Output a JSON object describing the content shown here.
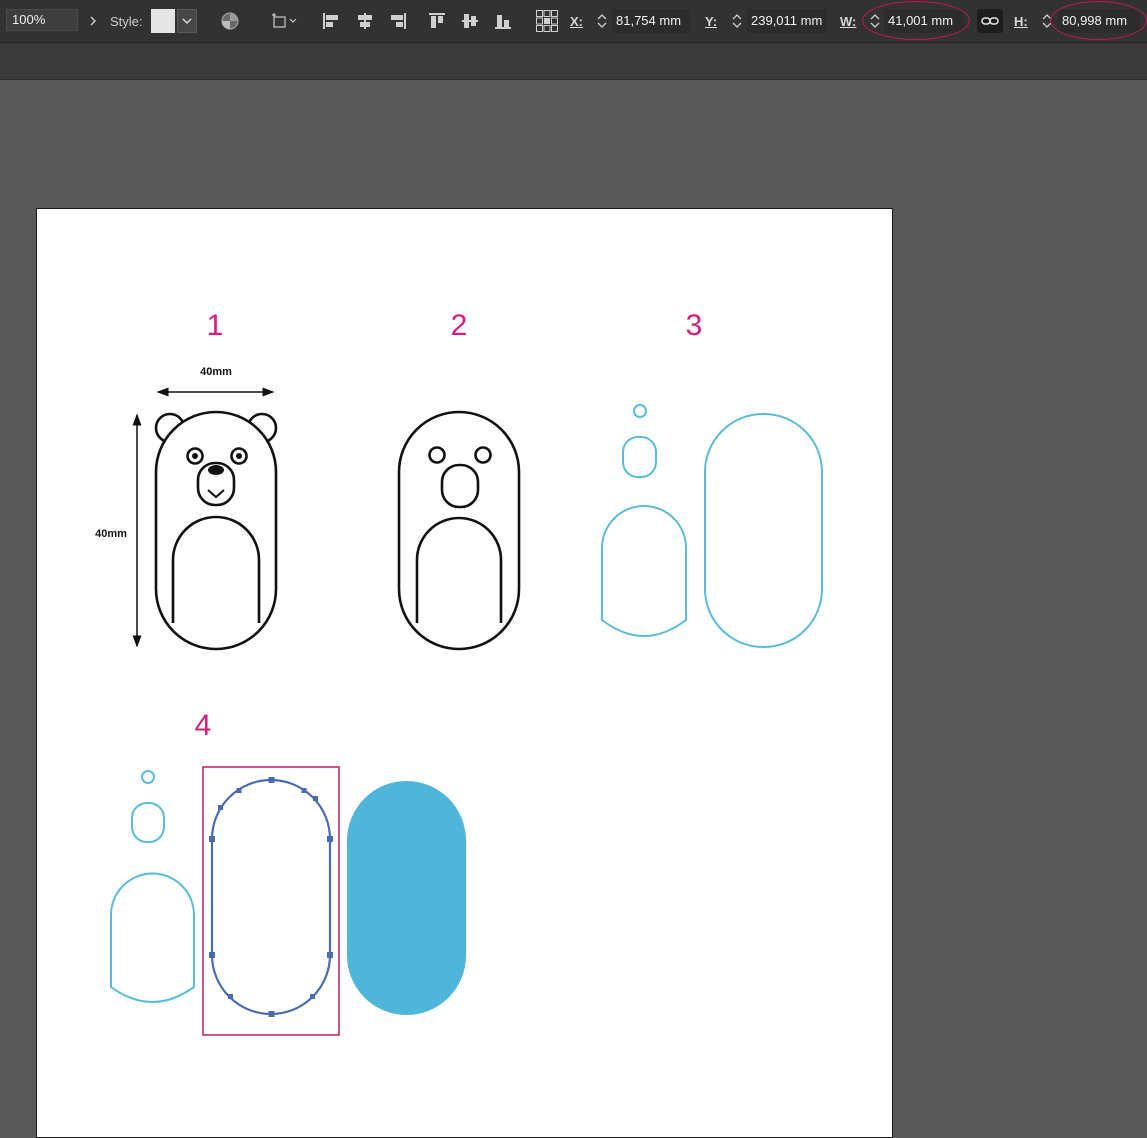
{
  "toolbar": {
    "zoom": "100%",
    "style_label": "Style:",
    "x_label": "X:",
    "x_value": "81,754 mm",
    "y_label": "Y:",
    "y_value": "239,011 mm",
    "w_label": "W:",
    "w_value": "41,001 mm",
    "h_label": "H:",
    "h_value": "80,998 mm"
  },
  "canvas": {
    "step_labels": [
      "1",
      "2",
      "3",
      "4"
    ],
    "dimension_width": "40mm",
    "dimension_height": "40mm"
  },
  "colors": {
    "app_bg": "#595959",
    "toolbar_bg": "#323232",
    "highlight": "#c2185b",
    "outline_cyan": "#5bbcd8",
    "fill_cyan": "#4fb6d9",
    "selection_blue": "#4a6bb0",
    "step_label": "#d81b7a"
  }
}
